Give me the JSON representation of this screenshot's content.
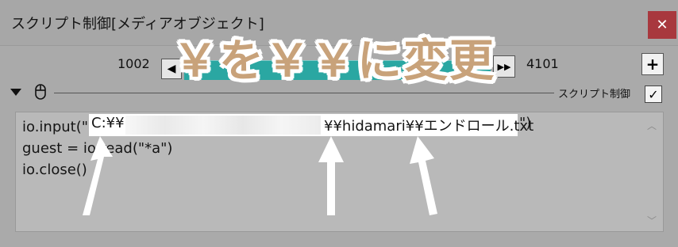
{
  "window": {
    "title": "スクリプト制御[メディアオブジェクト]",
    "close_glyph": "✕"
  },
  "timeline": {
    "start_frame": "1002",
    "end_frame": "4101",
    "prev_glyph": "◀",
    "next_glyph": "▶▶",
    "add_glyph": "+"
  },
  "section": {
    "label": "スクリプト制御",
    "enabled": true,
    "check_glyph": "✓"
  },
  "overlay": {
    "caption": "￥を￥￥に変更"
  },
  "editor": {
    "lines": [
      "io.input(\"",
      "guest =  io.read(\"*a\")",
      "io.close()"
    ],
    "highlighted_prefix": "C:¥¥",
    "highlighted_suffix": "¥¥hidamari¥¥エンドロール.txt",
    "line1_tail": "\")",
    "scroll_up_glyph": "︿",
    "scroll_down_glyph": "﹀"
  },
  "colors": {
    "track": "#2aa7a2",
    "close_button": "#a8383e",
    "caption": "#c8a27a"
  }
}
